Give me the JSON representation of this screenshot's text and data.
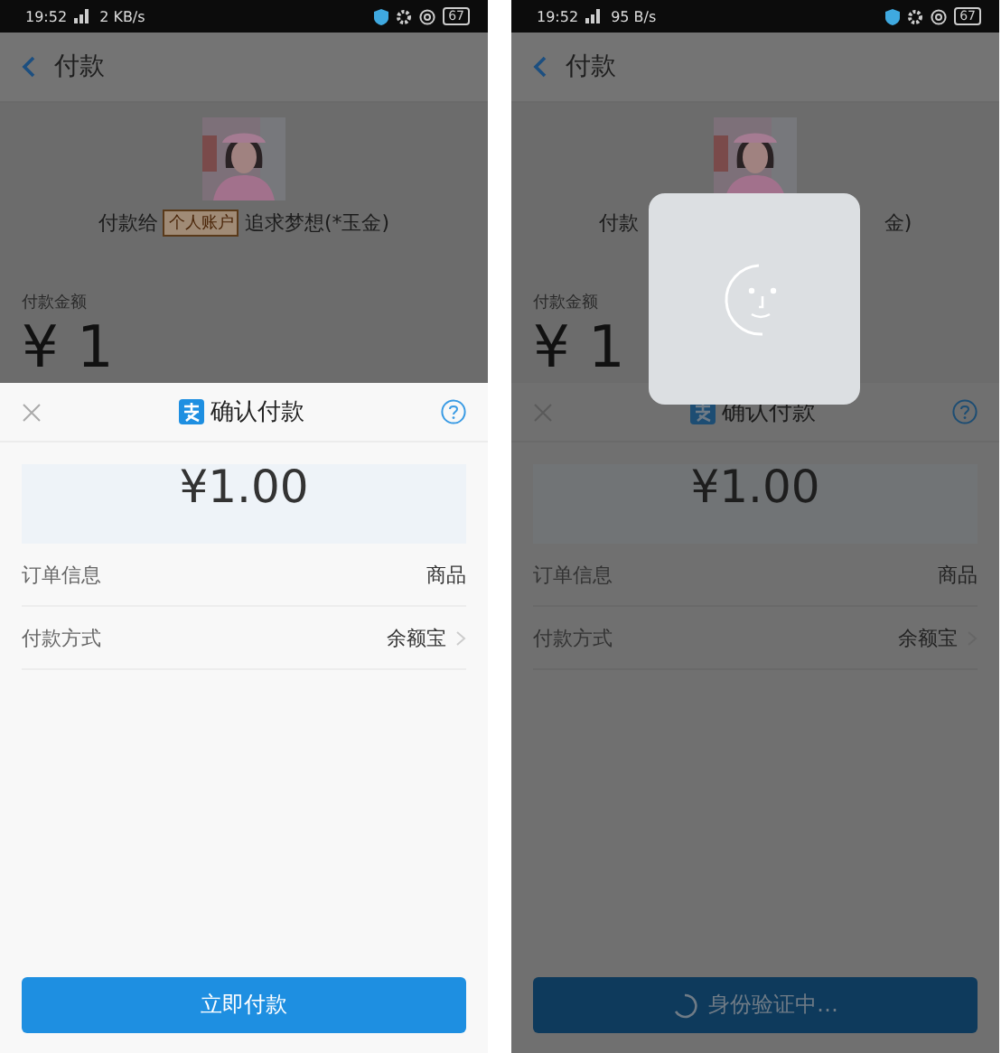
{
  "phones": [
    {
      "status_bar": {
        "time": "19:52",
        "speed": "2 KB/s",
        "battery": "67"
      },
      "header": {
        "title": "付款"
      },
      "payee": [
        {
          "kind": "text",
          "text": "付款给"
        },
        {
          "kind": "tag",
          "text": "个人账户"
        },
        {
          "kind": "text",
          "text": "追求梦想(*玉金)"
        }
      ],
      "amount_label": "付款金额",
      "amount_preview": "¥ 1",
      "sheet": {
        "title": "确认付款",
        "amount": "¥1.00",
        "rows": [
          {
            "label": "订单信息",
            "value": "商品",
            "chevron": false
          },
          {
            "label": "付款方式",
            "value": "余额宝",
            "chevron": true
          }
        ],
        "button": {
          "label": "立即付款",
          "loading": false
        }
      },
      "verifying": false
    },
    {
      "status_bar": {
        "time": "19:52",
        "speed": "95 B/s",
        "battery": "67"
      },
      "header": {
        "title": "付款"
      },
      "payee": [
        {
          "kind": "text",
          "text": "付款"
        },
        {
          "kind": "text",
          "text": "金)"
        }
      ],
      "amount_label": "付款金额",
      "amount_preview": "¥ 1",
      "sheet": {
        "title": "确认付款",
        "amount": "¥1.00",
        "rows": [
          {
            "label": "订单信息",
            "value": "商品",
            "chevron": false
          },
          {
            "label": "付款方式",
            "value": "余额宝",
            "chevron": true
          }
        ],
        "button": {
          "label": "身份验证中…",
          "loading": true
        }
      },
      "verifying": true
    }
  ]
}
